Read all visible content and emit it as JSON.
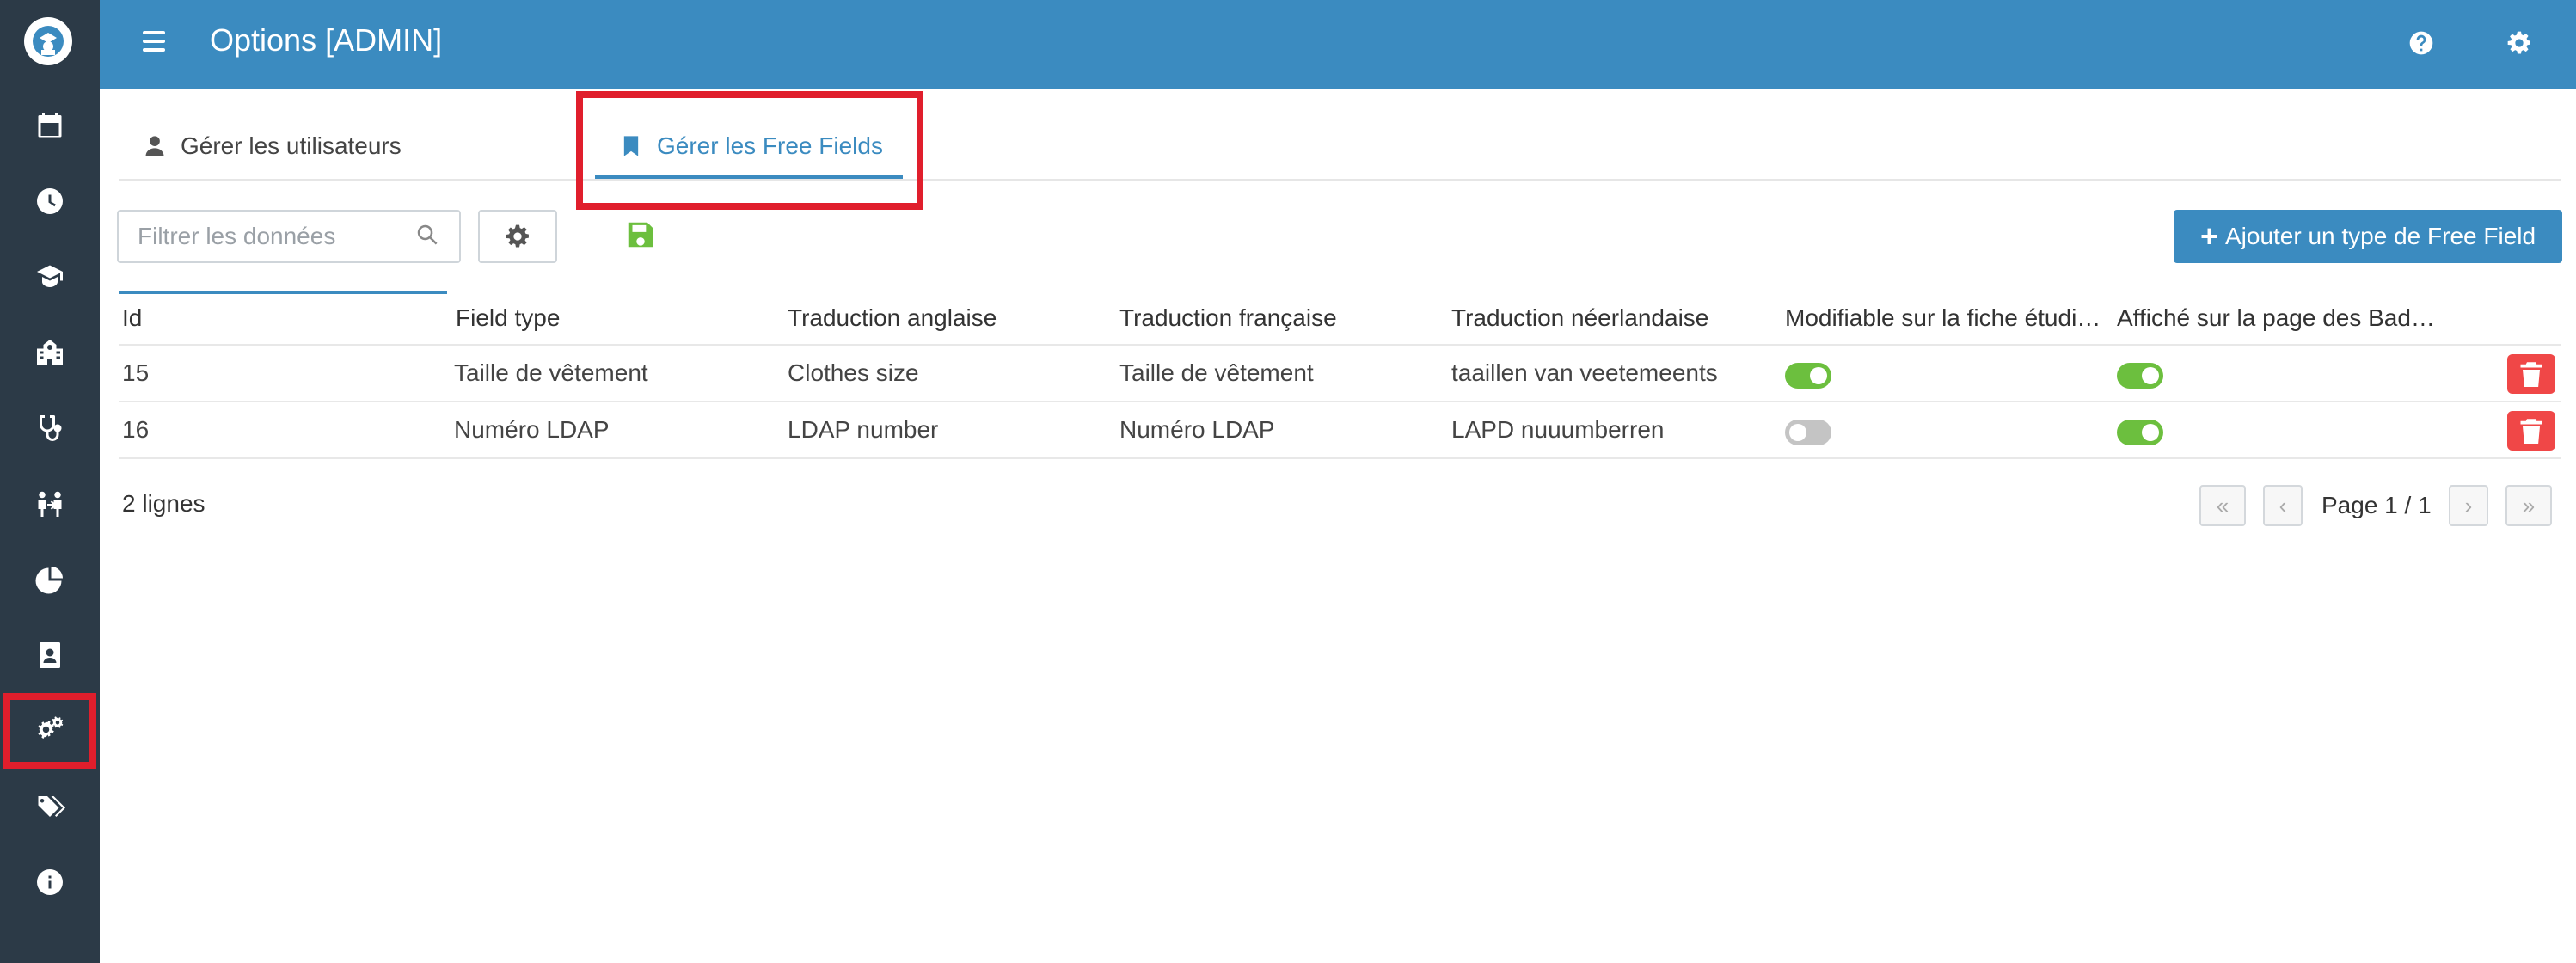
{
  "header": {
    "title": "Options [ADMIN]"
  },
  "tabs": [
    {
      "label": "Gérer les utilisateurs",
      "active": false
    },
    {
      "label": "Gérer les Free Fields",
      "active": true
    }
  ],
  "toolbar": {
    "filter_placeholder": "Filtrer les données",
    "add_label": "Ajouter un type de Free Field"
  },
  "table": {
    "columns": [
      "Id",
      "Field type",
      "Traduction anglaise",
      "Traduction française",
      "Traduction néerlandaise",
      "Modifiable sur la fiche étudi…",
      "Affiché sur la page des Bad…"
    ],
    "rows": [
      {
        "id": "15",
        "field_type": "Taille de vêtement",
        "en": "Clothes size",
        "fr": "Taille de vêtement",
        "nl": "taaillen van veetemeents",
        "editable": true,
        "badge": true
      },
      {
        "id": "16",
        "field_type": "Numéro LDAP",
        "en": "LDAP number",
        "fr": "Numéro LDAP",
        "nl": "LAPD nuuumberren",
        "editable": false,
        "badge": true
      }
    ]
  },
  "footer": {
    "count": "2 lignes",
    "page": "Page 1 / 1"
  },
  "colors": {
    "accent": "#3b8bc0",
    "sidebar": "#2c3a47",
    "toggle_on": "#6cbf3e",
    "danger": "#f04747",
    "highlight": "#e01e2c"
  },
  "icons": [
    "app-logo-icon",
    "calendar-icon",
    "clock-icon",
    "graduation-icon",
    "school-icon",
    "stethoscope-icon",
    "people-icon",
    "pie-chart-icon",
    "contact-card-icon",
    "cogs-icon",
    "tags-icon",
    "info-icon"
  ]
}
